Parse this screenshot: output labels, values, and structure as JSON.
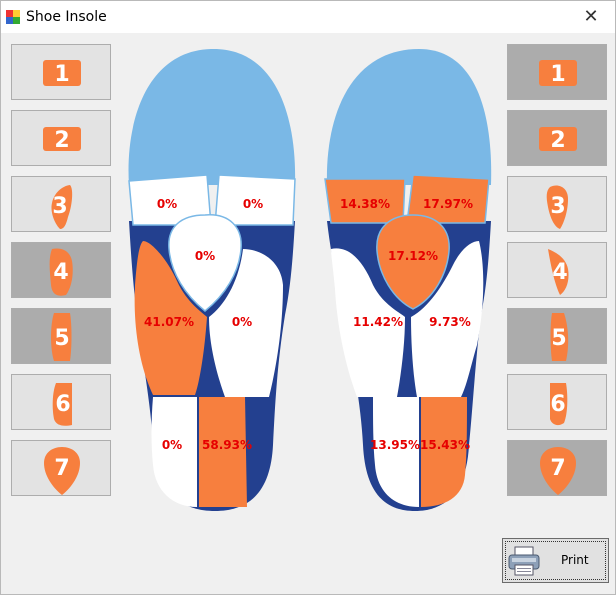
{
  "window": {
    "title": "Shoe Insole",
    "close_glyph": "✕"
  },
  "left_buttons": [
    {
      "label": "1",
      "pressed": false
    },
    {
      "label": "2",
      "pressed": false
    },
    {
      "label": "3",
      "pressed": false
    },
    {
      "label": "4",
      "pressed": true
    },
    {
      "label": "5",
      "pressed": true
    },
    {
      "label": "6",
      "pressed": false
    },
    {
      "label": "7",
      "pressed": false
    }
  ],
  "right_buttons": [
    {
      "label": "1",
      "pressed": true
    },
    {
      "label": "2",
      "pressed": true
    },
    {
      "label": "3",
      "pressed": false
    },
    {
      "label": "4",
      "pressed": false
    },
    {
      "label": "5",
      "pressed": true
    },
    {
      "label": "6",
      "pressed": false
    },
    {
      "label": "7",
      "pressed": true
    }
  ],
  "left_insole": {
    "zone1": "0%",
    "zone2": "0%",
    "zone3": "0%",
    "zone4": "41.07%",
    "zone5": "0%",
    "zone6": "0%",
    "zone7": "58.93%"
  },
  "right_insole": {
    "zone1": "14.38%",
    "zone2": "17.97%",
    "zone3": "17.12%",
    "zone4": "11.42%",
    "zone5": "9.73%",
    "zone6": "13.95%",
    "zone7": "15.43%"
  },
  "print": {
    "label": "Print"
  },
  "colors": {
    "toe": "#7ab8e6",
    "outline": "#23408f",
    "active": "#f77f3e",
    "inactive": "#ffffff",
    "percent": "#e60000",
    "button_pressed": "#acacac"
  }
}
